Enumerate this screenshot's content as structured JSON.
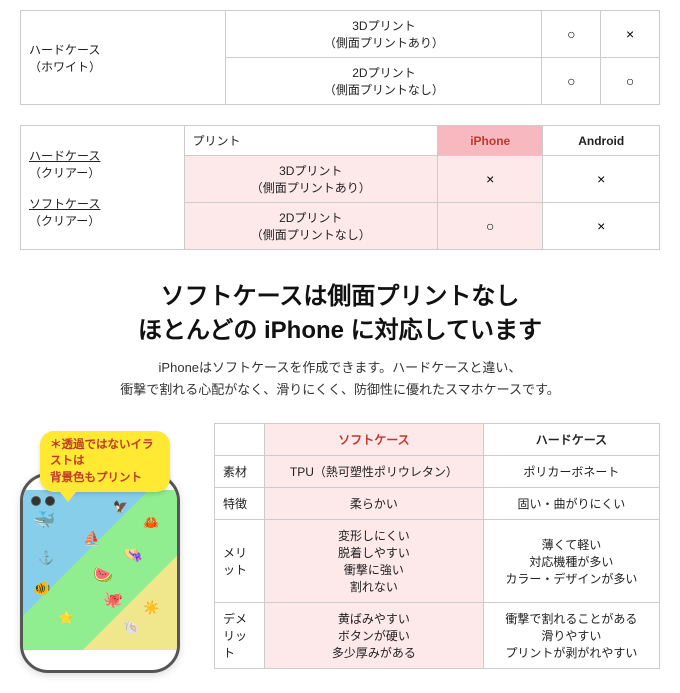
{
  "top_table": {
    "sections": [
      {
        "left_label": "ハードケース\n（ホワイト）",
        "rows": [
          {
            "label": "3Dプリント\n（側面プリントあり）",
            "iphone": "○",
            "android": "×"
          },
          {
            "label": "2Dプリント\n（側面プリントなし）",
            "iphone": "○",
            "android": "○"
          }
        ]
      }
    ],
    "section2_left_label1": "ハードケース\n（クリアー）",
    "section2_left_label2": "ソフトケース\n（クリアー）",
    "section2_header_iphone": "iPhone",
    "section2_header_android": "Android",
    "section2_rows": [
      {
        "label": "プリント",
        "iphone": "iPhone",
        "android": "Android",
        "is_header": true
      },
      {
        "label": "3Dプリント\n（側面プリントあり）",
        "iphone": "×",
        "android": "×"
      },
      {
        "label": "2Dプリント\n（側面プリントなし）",
        "iphone": "○",
        "android": "×"
      }
    ]
  },
  "headline": {
    "line1": "ソフトケースは側面プリントなし",
    "line2": "ほとんどの iPhone に対応しています",
    "body": "iPhoneはソフトケースを作成できます。ハードケースと違い、\n衝撃で割れる心配がなく、滑りにくく、防御性に優れたスマホケースです。"
  },
  "speech_bubble": {
    "line1": "＊透過ではないイラストは",
    "line2": "背景色もプリント"
  },
  "bottom_table": {
    "col_soft": "ソフトケース",
    "col_hard": "ハードケース",
    "rows": [
      {
        "label": "素材",
        "soft": "TPU（熱可塑性ポリウレタン）",
        "hard": "ポリカーボネート"
      },
      {
        "label": "特徴",
        "soft": "柔らかい",
        "hard": "固い・曲がりにくい"
      },
      {
        "label": "メリット",
        "soft": "変形しにくい\n脱着しやすい\n衝撃に強い\n割れない",
        "hard": "薄くて軽い\n対応機種が多い\nカラー・デザインが多い"
      },
      {
        "label": "デメリット",
        "soft": "黄ばみやすい\nボタンが硬い\n多少厚みがある",
        "hard": "衝撃で割れることがある\n滑りやすい\nプリントが剥がれやすい"
      }
    ]
  },
  "colors": {
    "pink_header": "#f8b8c0",
    "pink_bg": "#fde8ea",
    "accent_red": "#c0392b"
  }
}
